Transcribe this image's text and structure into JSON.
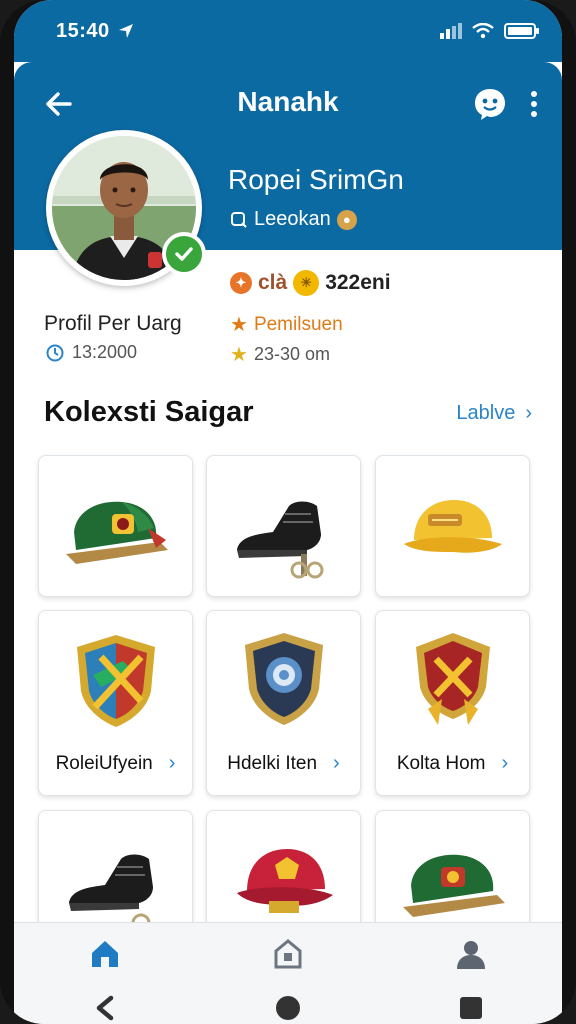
{
  "status_bar": {
    "time": "15:40"
  },
  "header": {
    "title": "Nanahk"
  },
  "profile": {
    "name": "Ropei SrimGn",
    "handle": "Leeokan",
    "badge_text": "clà",
    "badge_count": "322eni",
    "profil_label": "Profil Per Uarg",
    "profil_id": "13:2000",
    "stat_primary": "Pemilsuen",
    "stat_secondary": "23-30 om"
  },
  "collection": {
    "title": "Kolexsti Saigar",
    "link_label": "Lablve",
    "items": [
      {
        "label": "",
        "icon": "green-cap-icon"
      },
      {
        "label": "",
        "icon": "black-boot-icon"
      },
      {
        "label": "",
        "icon": "yellow-cap-icon"
      },
      {
        "label": "RoleiUfyein",
        "icon": "red-blue-shield-icon"
      },
      {
        "label": "Hdelki Iten",
        "icon": "blue-shield-icon"
      },
      {
        "label": "Kolta Hom",
        "icon": "red-gold-shield-icon"
      },
      {
        "label": "",
        "icon": "black-boot-icon"
      },
      {
        "label": "",
        "icon": "red-cap-icon"
      },
      {
        "label": "",
        "icon": "green-cap-icon"
      }
    ]
  },
  "colors": {
    "header_blue": "#0c6aa3",
    "accent_blue": "#2a84c9",
    "verified_green": "#3aa53a",
    "orange": "#e07a16"
  },
  "nav": {
    "items": [
      "home-icon",
      "store-icon",
      "profile-icon"
    ]
  }
}
